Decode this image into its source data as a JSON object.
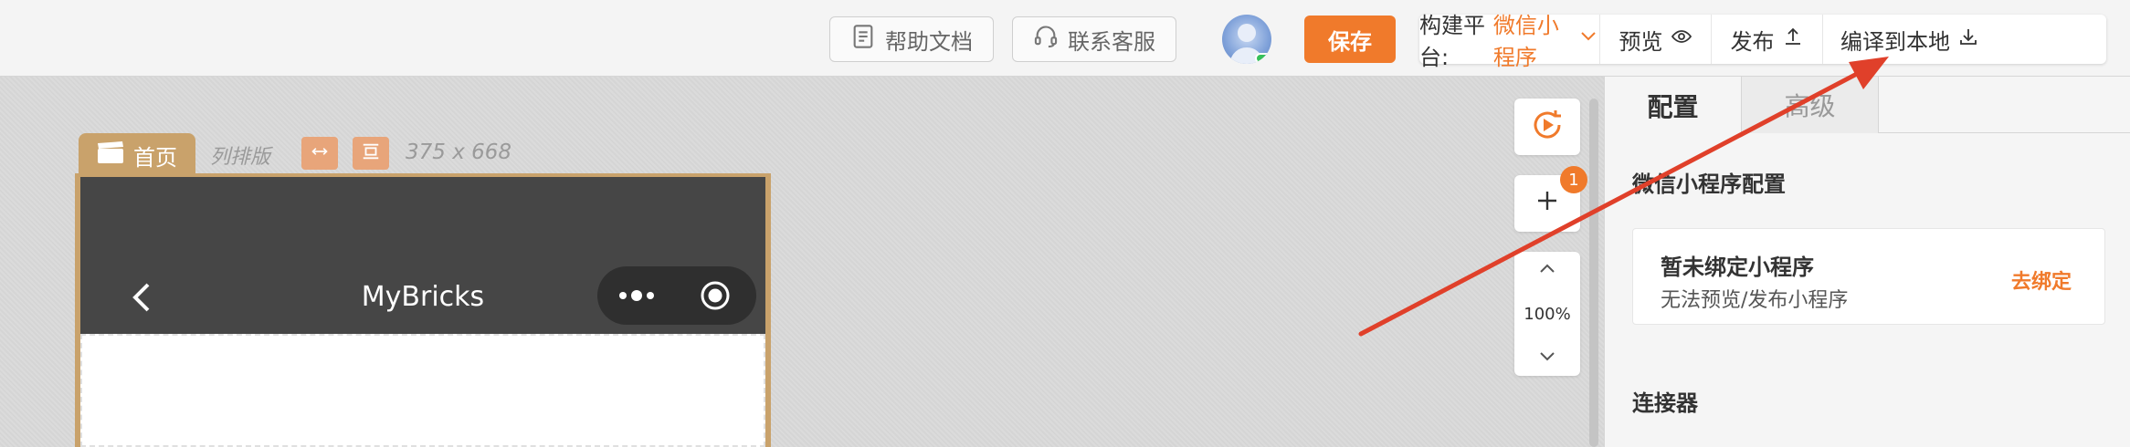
{
  "toolbar": {
    "help_docs": "帮助文档",
    "contact_support": "联系客服",
    "save": "保存",
    "platform_label": "构建平台:",
    "platform_value": "微信小程序",
    "preview": "预览",
    "publish": "发布",
    "compile_local": "编译到本地"
  },
  "canvas": {
    "page_tab": "首页",
    "layout_mode": "列排版",
    "size": "375 x 668",
    "phone_title": "MyBricks"
  },
  "tools": {
    "badge_count": "1",
    "zoom": "100%"
  },
  "panel": {
    "tabs": [
      "配置",
      "高级"
    ],
    "section_title": "微信小程序配置",
    "bind_title": "暂未绑定小程序",
    "bind_desc": "无法预览/发布小程序",
    "bind_link": "去绑定",
    "connector_title": "连接器"
  },
  "colors": {
    "accent": "#f07a2b",
    "page_tab": "#c9a26b",
    "phone_header": "#464646",
    "annotation_arrow": "#e0402a"
  }
}
